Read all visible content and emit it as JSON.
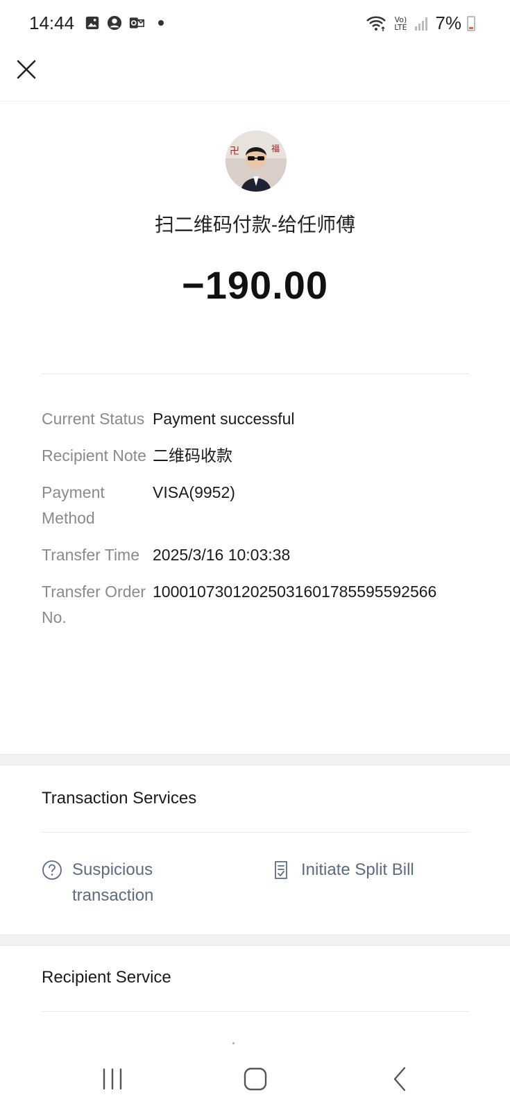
{
  "status_bar": {
    "time": "14:44",
    "network_label": "Vo) LTE",
    "battery": "7%",
    "icons": [
      "gallery-icon",
      "account-icon",
      "outlook-icon",
      "notification-dot",
      "wifi-icon",
      "volte-icon",
      "signal-icon",
      "battery-icon"
    ]
  },
  "header": {
    "close_icon": "close-icon"
  },
  "transaction": {
    "merchant_name": "扫二维码付款-给任师傅",
    "amount": "−190.00"
  },
  "details": [
    {
      "label": "Current Status",
      "value": "Payment successful"
    },
    {
      "label": "Recipient Note",
      "value": "二维码收款"
    },
    {
      "label": "Payment Method",
      "value": "VISA(9952)"
    },
    {
      "label": "Transfer Time",
      "value": "2025/3/16 10:03:38"
    },
    {
      "label": "Transfer Order No.",
      "value": "10001073012025031601785595592566"
    }
  ],
  "transaction_services": {
    "title": "Transaction Services",
    "items": [
      {
        "label": "Suspicious transaction",
        "icon": "question-circle-icon"
      },
      {
        "label": "Initiate Split Bill",
        "icon": "split-bill-icon"
      }
    ]
  },
  "recipient_service": {
    "title": "Recipient Service"
  },
  "nav_bar": {
    "icons": [
      "recent-apps-icon",
      "home-icon",
      "back-icon"
    ]
  },
  "colors": {
    "link": "#5b6b82",
    "label": "#8a8a8a",
    "text": "#1a1a1a",
    "section_gap": "#f2f2f2",
    "battery_low": "#e06a3a"
  }
}
